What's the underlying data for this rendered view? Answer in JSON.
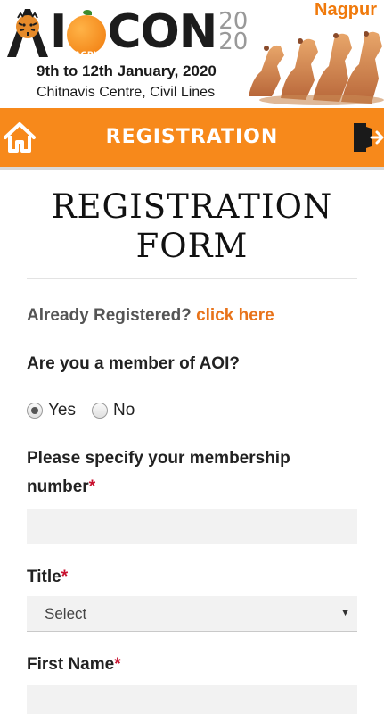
{
  "banner": {
    "logo_text": "AOICON",
    "logo_badge": "NAGPUR",
    "logo_year_top": "20",
    "logo_year_bottom": "20",
    "city": "Nagpur",
    "dates": "9th to 12th January, 2020",
    "venue": "Chitnavis Centre, Civil Lines"
  },
  "topbar": {
    "title": "REGISTRATION",
    "home_icon": "home-icon",
    "logout_icon": "logout-icon",
    "color": "#f7891b"
  },
  "form": {
    "title_line1": "REGISTRATION",
    "title_line2": "FORM",
    "already_text": "Already Registered?",
    "already_link": "click here",
    "link_color": "#e8731a",
    "member_question": "Are you a member of AOI?",
    "member_options": [
      {
        "label": "Yes",
        "checked": true
      },
      {
        "label": "No",
        "checked": false
      }
    ],
    "membership_label_line1": "Please specify your membership",
    "membership_label_line2": "number",
    "membership_value": "",
    "title_label": "Title",
    "title_selected": "Select",
    "first_name_label": "First Name",
    "first_name_value": "",
    "required_mark": "*",
    "required_color": "#c8102e"
  }
}
